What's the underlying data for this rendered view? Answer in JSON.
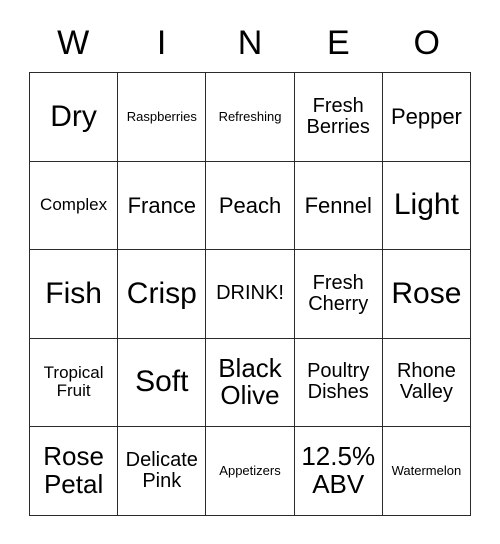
{
  "card": {
    "header_letters": [
      "W",
      "I",
      "N",
      "E",
      "O"
    ],
    "rows": [
      [
        {
          "text": "Dry",
          "size": "xxl"
        },
        {
          "text": "Raspberries",
          "size": "xs"
        },
        {
          "text": "Refreshing",
          "size": "xs"
        },
        {
          "text": "Fresh Berries",
          "size": "md"
        },
        {
          "text": "Pepper",
          "size": "lg"
        }
      ],
      [
        {
          "text": "Complex",
          "size": "sm"
        },
        {
          "text": "France",
          "size": "lg"
        },
        {
          "text": "Peach",
          "size": "lg"
        },
        {
          "text": "Fennel",
          "size": "lg"
        },
        {
          "text": "Light",
          "size": "xxl"
        }
      ],
      [
        {
          "text": "Fish",
          "size": "xxl"
        },
        {
          "text": "Crisp",
          "size": "xxl"
        },
        {
          "text": "DRINK!",
          "size": "md"
        },
        {
          "text": "Fresh Cherry",
          "size": "md"
        },
        {
          "text": "Rose",
          "size": "xxl"
        }
      ],
      [
        {
          "text": "Tropical Fruit",
          "size": "sm"
        },
        {
          "text": "Soft",
          "size": "xxl"
        },
        {
          "text": "Black Olive",
          "size": "xl"
        },
        {
          "text": "Poultry Dishes",
          "size": "md"
        },
        {
          "text": "Rhone Valley",
          "size": "md"
        }
      ],
      [
        {
          "text": "Rose Petal",
          "size": "xl"
        },
        {
          "text": "Delicate Pink",
          "size": "md"
        },
        {
          "text": "Appetizers",
          "size": "xs"
        },
        {
          "text": "12.5% ABV",
          "size": "xl"
        },
        {
          "text": "Watermelon",
          "size": "xs"
        }
      ]
    ]
  },
  "colors": {
    "background": "#ffffff",
    "text": "#000000",
    "border": "#2b2b2b"
  }
}
